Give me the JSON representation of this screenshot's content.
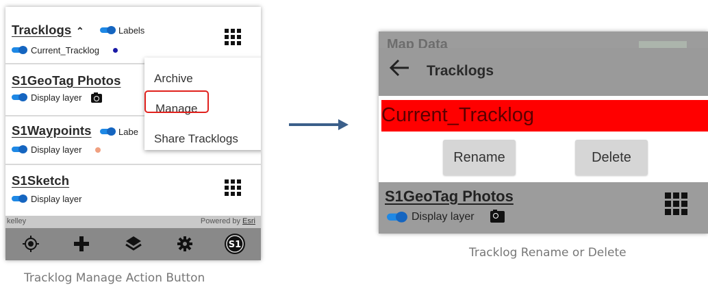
{
  "left_panel": {
    "layers": [
      {
        "title": "Tracklogs",
        "toggle_label": "Labels",
        "sub_label": "Current_Tracklog"
      },
      {
        "title": "S1GeoTag Photos",
        "sub_label": "Display layer"
      },
      {
        "title": "S1Waypoints",
        "toggle_label": "Labe",
        "sub_label": "Display layer"
      },
      {
        "title": "S1Sketch",
        "sub_label": "Display layer"
      }
    ],
    "menu": {
      "items": [
        "Archive",
        "Manage",
        "Share Tracklogs"
      ]
    },
    "map_strip": {
      "left_text": "kelley",
      "right_text": "Powered by",
      "right_link": "Esri"
    },
    "bottom_bar": [
      "locate-icon",
      "plus-icon",
      "layers-icon",
      "gear-icon",
      "s1-logo-icon"
    ]
  },
  "right_panel": {
    "ghost_title": "Map Data",
    "header_title": "Tracklogs",
    "selected_name": "Current_Tracklog",
    "buttons": {
      "rename": "Rename",
      "delete": "Delete"
    },
    "layer_title": "S1GeoTag Photos",
    "layer_sub": "Display layer"
  },
  "captions": {
    "left": "Tracklog Manage Action Button",
    "right": "Tracklog Rename or Delete"
  },
  "colors": {
    "toggle_blue": "#1e88e5",
    "highlight_red": "#ff0000",
    "manage_outline": "#e0201c",
    "arrow": "#3b5f8a"
  }
}
